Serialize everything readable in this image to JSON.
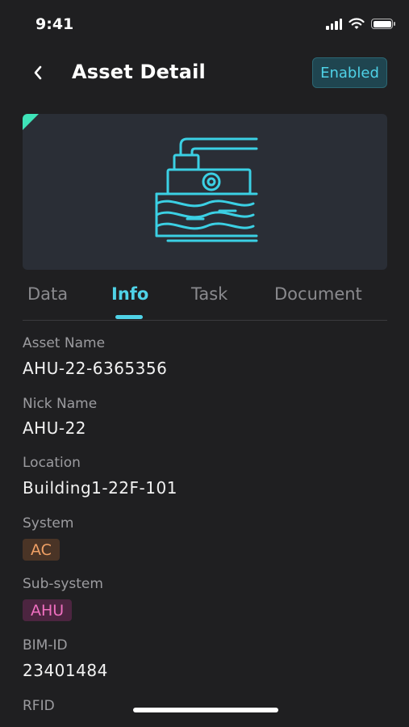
{
  "status_bar": {
    "time": "9:41"
  },
  "header": {
    "title": "Asset Detail",
    "status_badge": "Enabled"
  },
  "tabs": [
    {
      "label": "Data"
    },
    {
      "label": "Info",
      "active": true
    },
    {
      "label": "Task"
    },
    {
      "label": "Document"
    }
  ],
  "fields": {
    "asset_name": {
      "label": "Asset Name",
      "value": "AHU-22-6365356"
    },
    "nick_name": {
      "label": "Nick Name",
      "value": "AHU-22"
    },
    "location": {
      "label": "Location",
      "value": "Building1-22F-101"
    },
    "system": {
      "label": "System",
      "value": "AC"
    },
    "sub_system": {
      "label": "Sub-system",
      "value": "AHU"
    },
    "bim_id": {
      "label": "BIM-ID",
      "value": "23401484"
    },
    "rfid": {
      "label": "RFID"
    }
  },
  "colors": {
    "accent": "#4fd2e7",
    "background": "#1f1f21",
    "system_tag": "#f0a065",
    "subsystem_tag": "#f070c0",
    "corner_marker": "#3ee3b8"
  },
  "icons": [
    "back-arrow-icon",
    "cellular-signal-icon",
    "wifi-icon",
    "battery-icon",
    "air-handling-unit-icon"
  ]
}
